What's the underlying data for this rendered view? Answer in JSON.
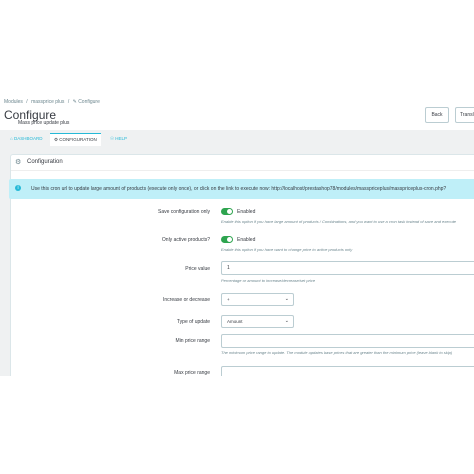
{
  "breadcrumb": [
    "Modules",
    "/",
    "massprice plus",
    "/",
    "✎ Configure"
  ],
  "header": {
    "title": "Configure",
    "subtitle": "Mass price update plus",
    "back_label": "Back",
    "trans_label": "Transl"
  },
  "tabs": [
    {
      "icon": "home-icon",
      "label": "⌂ DASHBOARD"
    },
    {
      "icon": "gear-icon",
      "label": "⚙ CONFIGURATION"
    },
    {
      "icon": "help-icon",
      "label": "☉ HELP"
    }
  ],
  "panel": {
    "title": "Configuration"
  },
  "alert": {
    "text": "Use this cron url to update large amount of products (execute only once), or click on the link to execute now: http://localhost/prestashop78/modules/masspriceplus/masspriceplus-cron.php?"
  },
  "fields": {
    "save_config": {
      "label": "Save configuration only",
      "value": "Enabled",
      "help": "Enable this option if you have large amount of products / Combinations, and you want to use a cron task instead of save and execute"
    },
    "only_active": {
      "label": "Only active products?",
      "value": "Enabled",
      "help": "Enable this option if you have want to change price to active products only"
    },
    "price_value": {
      "label": "Price value",
      "value": "1",
      "help": "Percentage or amount to increase/decrease/set price"
    },
    "increase_decrease": {
      "label": "Increase or decrease",
      "value": "+"
    },
    "type_update": {
      "label": "Type of update",
      "value": "Amount"
    },
    "min_price": {
      "label": "Min price range",
      "value": "",
      "help": "The minimum price range to update. The module updates base prices that are greater than the minimum price (leave blank to skip)"
    },
    "max_price": {
      "label": "Max price range",
      "value": ""
    }
  },
  "colors": {
    "accent": "#25b9d7",
    "toggle_on": "#2ea44f",
    "alert_bg": "#bfeff8",
    "page_bg": "#eff1f2"
  }
}
